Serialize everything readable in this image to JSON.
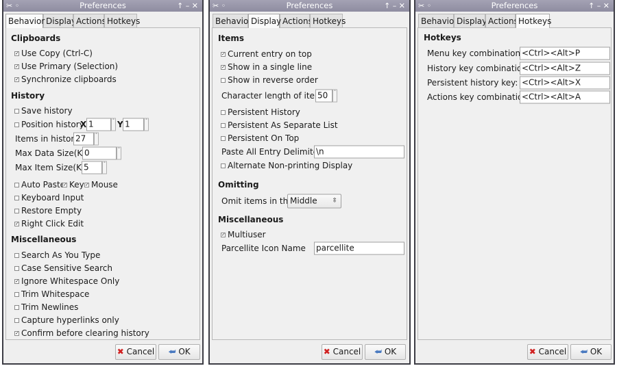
{
  "windows": [
    {
      "title": "Preferences",
      "tabs": [
        "Behavior",
        "Display",
        "Actions",
        "Hotkeys"
      ],
      "selected_tab": "Behavior",
      "clipboards": {
        "heading": "Clipboards",
        "use_copy": {
          "label": "Use Copy (Ctrl-C)",
          "checked": true
        },
        "use_primary": {
          "label": "Use Primary (Selection)",
          "checked": true
        },
        "synchronize": {
          "label": "Synchronize clipboards",
          "checked": true
        }
      },
      "history": {
        "heading": "History",
        "save_history": {
          "label": "Save history",
          "checked": false
        },
        "position_history": {
          "label": "Position history",
          "checked": false
        },
        "x_label": "X",
        "x_value": "1",
        "y_label": "Y",
        "y_value": "1",
        "items_label": "Items in history",
        "items_value": "27",
        "max_data_label": "Max Data Size(KB)",
        "max_data_value": "0",
        "max_item_label": "Max Item Size(KB)",
        "max_item_value": "5",
        "auto_paste": {
          "label": "Auto Paste",
          "checked": false
        },
        "key": {
          "label": "Key",
          "checked": true
        },
        "mouse": {
          "label": "Mouse",
          "checked": true
        },
        "keyboard_input": {
          "label": "Keyboard Input",
          "checked": false
        },
        "restore_empty": {
          "label": "Restore Empty",
          "checked": false
        },
        "right_click_edit": {
          "label": "Right Click Edit",
          "checked": true
        }
      },
      "misc": {
        "heading": "Miscellaneous",
        "items": [
          {
            "label": "Search As You Type",
            "checked": false
          },
          {
            "label": "Case Sensitive Search",
            "checked": false
          },
          {
            "label": "Ignore Whitespace Only",
            "checked": true
          },
          {
            "label": "Trim Whitespace",
            "checked": false
          },
          {
            "label": "Trim Newlines",
            "checked": false
          },
          {
            "label": "Capture hyperlinks only",
            "checked": false
          },
          {
            "label": "Confirm before clearing history",
            "checked": true
          }
        ]
      },
      "cancel": "Cancel",
      "ok": "OK"
    },
    {
      "title": "Preferences",
      "tabs": [
        "Behavior",
        "Display",
        "Actions",
        "Hotkeys"
      ],
      "selected_tab": "Display",
      "items": {
        "heading": "Items",
        "current_on_top": {
          "label": "Current entry on top",
          "checked": true
        },
        "single_line": {
          "label": "Show in a single line",
          "checked": true
        },
        "reverse": {
          "label": "Show in reverse order",
          "checked": false
        },
        "char_length_label": "Character length of items",
        "char_length_value": "50",
        "persistent_history": {
          "label": "Persistent History",
          "checked": false
        },
        "persistent_separate": {
          "label": "Persistent As Separate List",
          "checked": false
        },
        "persistent_top": {
          "label": "Persistent On Top",
          "checked": false
        },
        "delimiter_label": "Paste All Entry Delimiter",
        "delimiter_value": "\\n",
        "alternate": {
          "label": "Alternate Non-printing Display",
          "checked": false
        }
      },
      "omitting": {
        "heading": "Omitting",
        "omit_label": "Omit items in the:",
        "omit_value": "Middle"
      },
      "misc": {
        "heading": "Miscellaneous",
        "multiuser": {
          "label": "Multiuser",
          "checked": true
        },
        "icon_name_label": "Parcellite Icon Name",
        "icon_name_value": "parcellite"
      },
      "cancel": "Cancel",
      "ok": "OK"
    },
    {
      "title": "Preferences",
      "tabs": [
        "Behavior",
        "Display",
        "Actions",
        "Hotkeys"
      ],
      "selected_tab": "Hotkeys",
      "hotkeys": {
        "heading": "Hotkeys",
        "rows": [
          {
            "label": "Menu key combination",
            "value": "<Ctrl><Alt>P"
          },
          {
            "label": "History key combination:",
            "value": "<Ctrl><Alt>Z"
          },
          {
            "label": "Persistent history key:",
            "value": "<Ctrl><Alt>X"
          },
          {
            "label": "Actions key combination:",
            "value": "<Ctrl><Alt>A"
          }
        ]
      },
      "cancel": "Cancel",
      "ok": "OK"
    }
  ]
}
